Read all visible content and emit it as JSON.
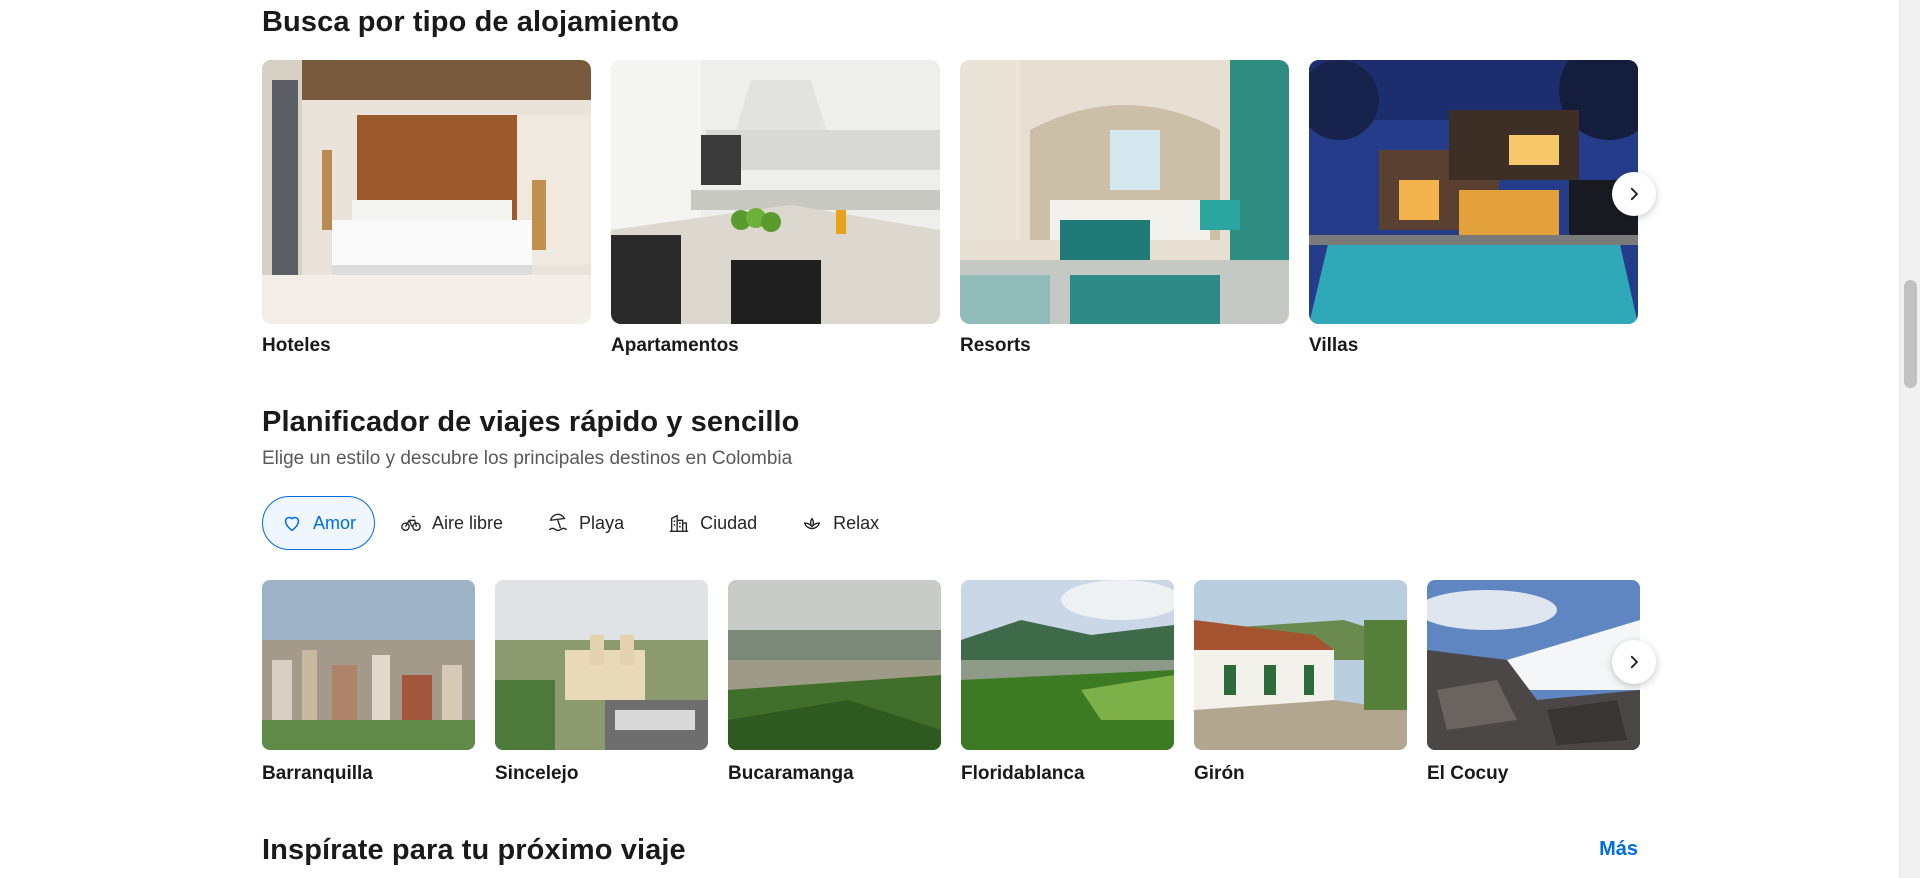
{
  "types_section": {
    "title": "Busca por tipo de alojamiento",
    "items": [
      {
        "label": "Hoteles"
      },
      {
        "label": "Apartamentos"
      },
      {
        "label": "Resorts"
      },
      {
        "label": "Villas"
      }
    ]
  },
  "planner_section": {
    "title": "Planificador de viajes rápido y sencillo",
    "subtitle": "Elige un estilo y descubre los principales destinos en Colombia",
    "chips": [
      {
        "label": "Amor",
        "icon": "heart-icon",
        "active": true
      },
      {
        "label": "Aire libre",
        "icon": "bicycle-icon",
        "active": false
      },
      {
        "label": "Playa",
        "icon": "beach-icon",
        "active": false
      },
      {
        "label": "Ciudad",
        "icon": "city-icon",
        "active": false
      },
      {
        "label": "Relax",
        "icon": "lotus-icon",
        "active": false
      }
    ],
    "destinations": [
      {
        "label": "Barranquilla"
      },
      {
        "label": "Sincelejo"
      },
      {
        "label": "Bucaramanga"
      },
      {
        "label": "Floridablanca"
      },
      {
        "label": "Girón"
      },
      {
        "label": "El Cocuy"
      }
    ]
  },
  "inspire_section": {
    "title": "Inspírate para tu próximo viaje",
    "more_label": "Más"
  },
  "colors": {
    "accent": "#006ce4",
    "text": "#1a1a1a",
    "muted": "#595959"
  }
}
